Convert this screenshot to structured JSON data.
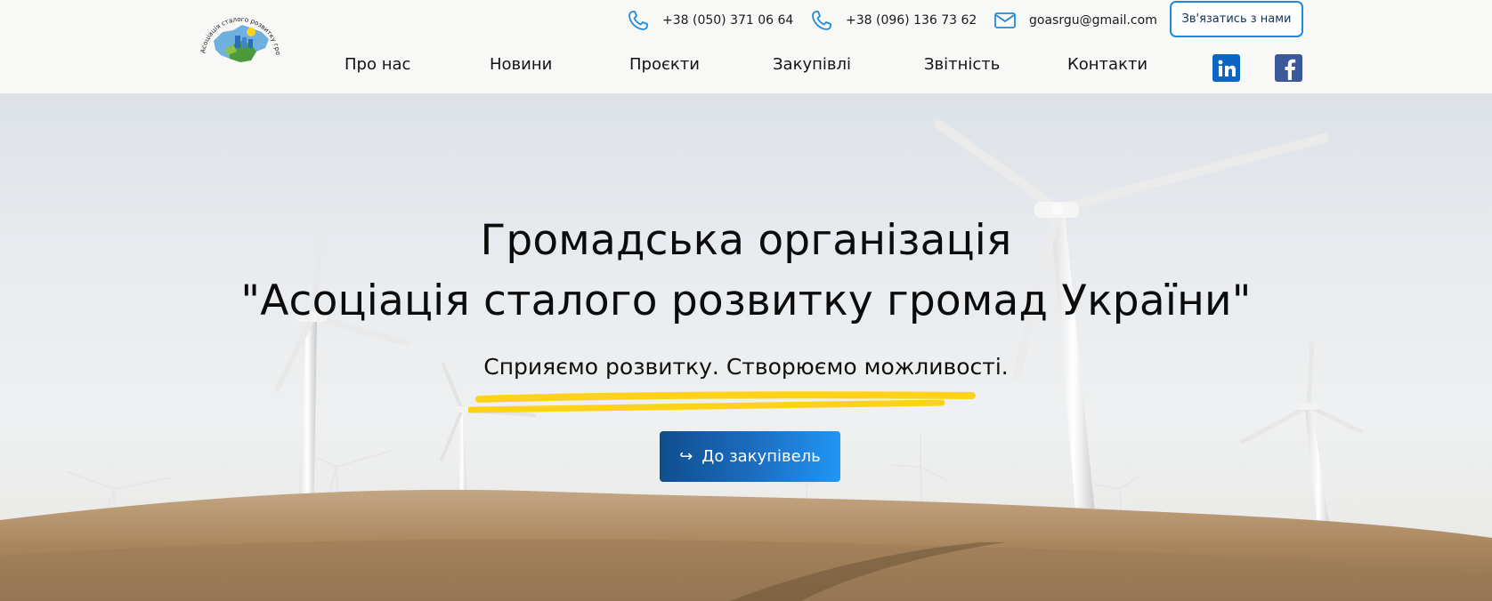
{
  "header": {
    "logo_text": "Асоціація сталого розвитку громад України",
    "phone1": "+38 (050) 371 06 64",
    "phone2": "+38 (096) 136 73 62",
    "email": "goasrgu@gmail.com",
    "cta_label": "Зв'язатись з нами"
  },
  "nav": {
    "items": [
      "Про нас",
      "Новини",
      "Проєкти",
      "Закупівлі",
      "Звітність",
      "Контакти"
    ]
  },
  "social": {
    "linkedin": "in",
    "facebook": "f"
  },
  "hero": {
    "title_line1": "Громадська організація",
    "title_line2": "\"Асоціація сталого розвитку громад України\"",
    "tagline": "Сприяємо розвитку. Створюємо можливості.",
    "button_arrow": "↪",
    "button_label": "До закупівель"
  },
  "colors": {
    "accent": "#1f8ad8",
    "button_dark": "#0f4e8c",
    "button_light": "#2196f3",
    "underline_yellow": "#ffd21a",
    "linkedin": "#0a66c2",
    "facebook": "#3b5998"
  }
}
